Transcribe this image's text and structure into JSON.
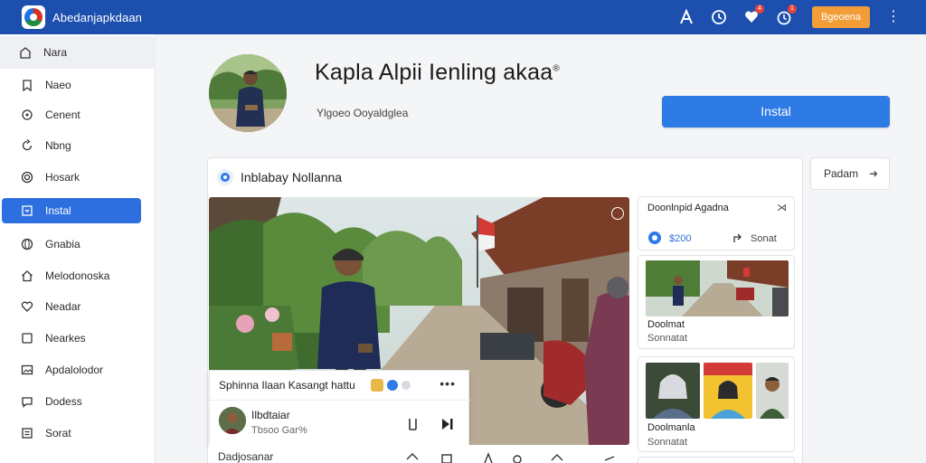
{
  "app": {
    "title": "Abedanjapkdaan"
  },
  "topbar": {
    "icons": [
      "letter-a-icon",
      "clock-icon",
      "heart-icon",
      "timer-icon"
    ],
    "badges": {
      "heart": "4",
      "timer": "1"
    },
    "button_label": "Bgeoena",
    "menu": "⋮"
  },
  "sidebar": {
    "items": [
      {
        "label": "Nara",
        "icon": "home-icon"
      },
      {
        "label": "Naeo",
        "icon": "bookmark-icon"
      },
      {
        "label": "Cenent",
        "icon": "circle-icon"
      },
      {
        "label": "Nbng",
        "icon": "refresh-icon"
      },
      {
        "label": "Hosark",
        "icon": "target-icon"
      },
      {
        "label": "Instal",
        "icon": "download-icon"
      },
      {
        "label": "Gnabia",
        "icon": "globe-icon"
      },
      {
        "label": "Melodonoska",
        "icon": "house-icon"
      },
      {
        "label": "Neadar",
        "icon": "heart-icon"
      },
      {
        "label": "Nearkes",
        "icon": "square-icon"
      },
      {
        "label": "Apdalolodor",
        "icon": "image-icon"
      },
      {
        "label": "Dodess",
        "icon": "chat-icon"
      },
      {
        "label": "Sorat",
        "icon": "list-icon"
      }
    ]
  },
  "header": {
    "title": "Kapla Alpii Ienling akaa",
    "title_mark": "®",
    "subtitle": "Ylgoeo Ooyaldglea",
    "install_label": "Instal"
  },
  "panel": {
    "heading": "Inblabay Nollanna",
    "side_button": "Padam",
    "side_button_arrow": "➜"
  },
  "video_card": {
    "title": "Sphinna Ilaan Kasangt hattu",
    "more": "•••",
    "channel": "Ilbdtaiar",
    "meta": "Tbsoo Gar%"
  },
  "bottom_row": {
    "label": "Dadjosanar"
  },
  "right_cards": {
    "card1": {
      "title": "Doonlnpid Agadna",
      "close": "⋊",
      "price": "$200",
      "subtitle": "Sonat"
    },
    "card2": {
      "title": "Doolmat",
      "subtitle": "Sonnatat"
    },
    "card3": {
      "title": "Doolmanla",
      "subtitle": "Sonnatat"
    }
  },
  "colors": {
    "topbar": "#1d4fae",
    "accent": "#2f7be5",
    "active_nav": "#2e6fe0",
    "orange_button": "#f29d38",
    "badge": "#e8453c"
  }
}
